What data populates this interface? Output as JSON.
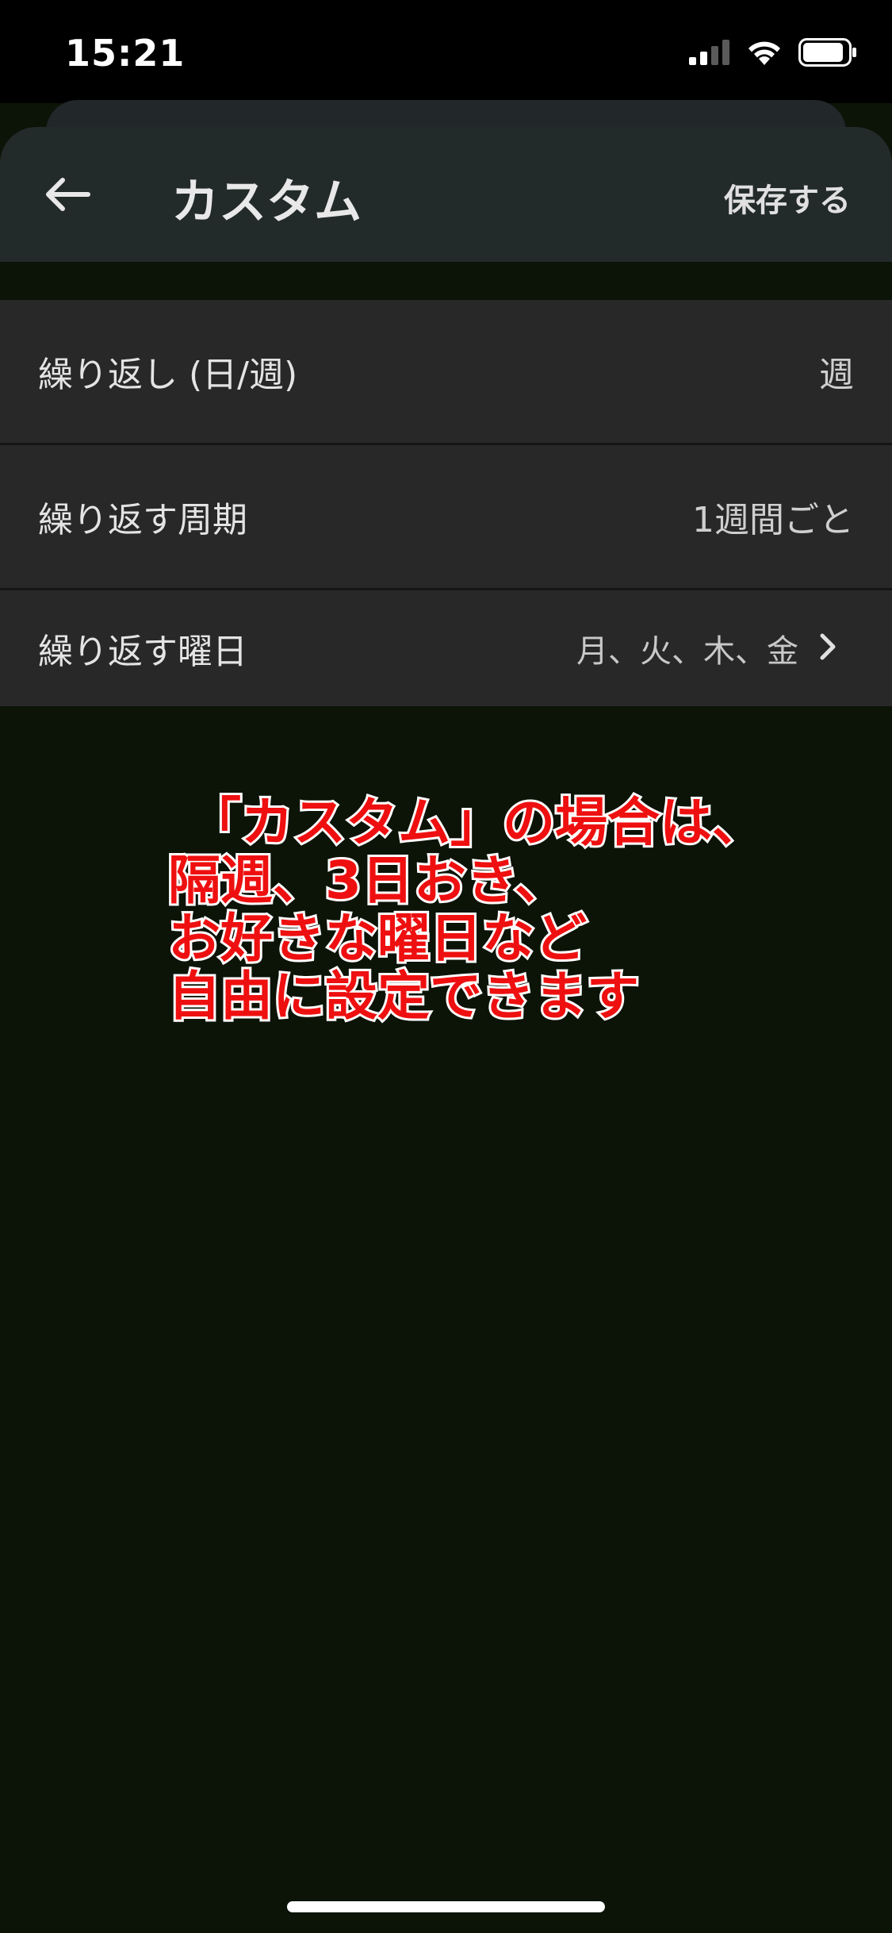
{
  "status_bar": {
    "time": "15:21"
  },
  "header": {
    "title": "カスタム",
    "save_label": "保存する"
  },
  "settings": {
    "rows": [
      {
        "label": "繰り返し (日/週)",
        "value": "週"
      },
      {
        "label": "繰り返す周期",
        "value": "1週間ごと"
      },
      {
        "label": "繰り返す曜日",
        "value": "月、火、木、金"
      }
    ]
  },
  "annotation": {
    "lines": [
      "「カスタム」の場合は、",
      "隔週、3日おき、",
      "お好きな曜日など",
      "自由に設定できます"
    ]
  },
  "colors": {
    "status_bar": "#000000",
    "header": "#232a2a",
    "row": "#282828",
    "background": "#0c1408",
    "annotation": "#ee1010"
  }
}
